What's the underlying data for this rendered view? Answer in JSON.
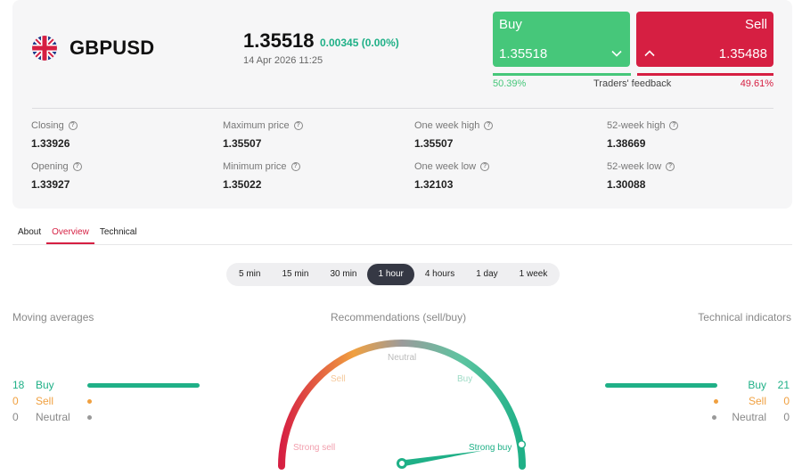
{
  "instrument": {
    "symbol": "GBPUSD",
    "price": "1.35518",
    "change": "0.00345 (0.00%)",
    "datetime": "14 Apr 2026 11:25"
  },
  "buy_button": {
    "label": "Buy",
    "price": "1.35518",
    "icon": "chevron-down-icon"
  },
  "sell_button": {
    "label": "Sell",
    "price": "1.35488",
    "icon": "chevron-up-icon"
  },
  "feedback": {
    "buy_percent": "50.39%",
    "label": "Traders' feedback",
    "sell_percent": "49.61%",
    "buy_share": 0.5039
  },
  "stats": [
    {
      "label": "Closing",
      "value": "1.33926"
    },
    {
      "label": "Maximum price",
      "value": "1.35507"
    },
    {
      "label": "One week high",
      "value": "1.35507"
    },
    {
      "label": "52-week high",
      "value": "1.38669"
    },
    {
      "label": "Opening",
      "value": "1.33927"
    },
    {
      "label": "Minimum price",
      "value": "1.35022"
    },
    {
      "label": "One week low",
      "value": "1.32103"
    },
    {
      "label": "52-week low",
      "value": "1.30088"
    }
  ],
  "tabs": [
    {
      "label": "About",
      "active": false
    },
    {
      "label": "Overview",
      "active": true
    },
    {
      "label": "Technical",
      "active": false
    }
  ],
  "timeframes": [
    {
      "label": "5 min",
      "active": false
    },
    {
      "label": "15 min",
      "active": false
    },
    {
      "label": "30 min",
      "active": false
    },
    {
      "label": "1 hour",
      "active": true
    },
    {
      "label": "4 hours",
      "active": false
    },
    {
      "label": "1 day",
      "active": false
    },
    {
      "label": "1 week",
      "active": false
    }
  ],
  "moving_averages": {
    "title": "Moving averages",
    "rows": [
      {
        "count": "18",
        "label": "Buy",
        "color": "#1fb087"
      },
      {
        "count": "0",
        "label": "Sell",
        "color": "#f0a040"
      },
      {
        "count": "0",
        "label": "Neutral",
        "color": "#999999"
      }
    ]
  },
  "recommendations": {
    "title": "Recommendations (sell/buy)",
    "labels": {
      "strong_sell": "Strong sell",
      "sell": "Sell",
      "neutral": "Neutral",
      "buy": "Buy",
      "strong_buy": "Strong buy"
    },
    "needle_level": 0.95
  },
  "technical_indicators": {
    "title": "Technical indicators",
    "rows": [
      {
        "label": "Buy",
        "count": "21",
        "color": "#1fb087"
      },
      {
        "label": "Sell",
        "count": "0",
        "color": "#f0a040"
      },
      {
        "label": "Neutral",
        "count": "0",
        "color": "#999999"
      }
    ]
  },
  "colors": {
    "buy": "#46c77a",
    "sell": "#d61f42",
    "accent": "#1fb087"
  }
}
